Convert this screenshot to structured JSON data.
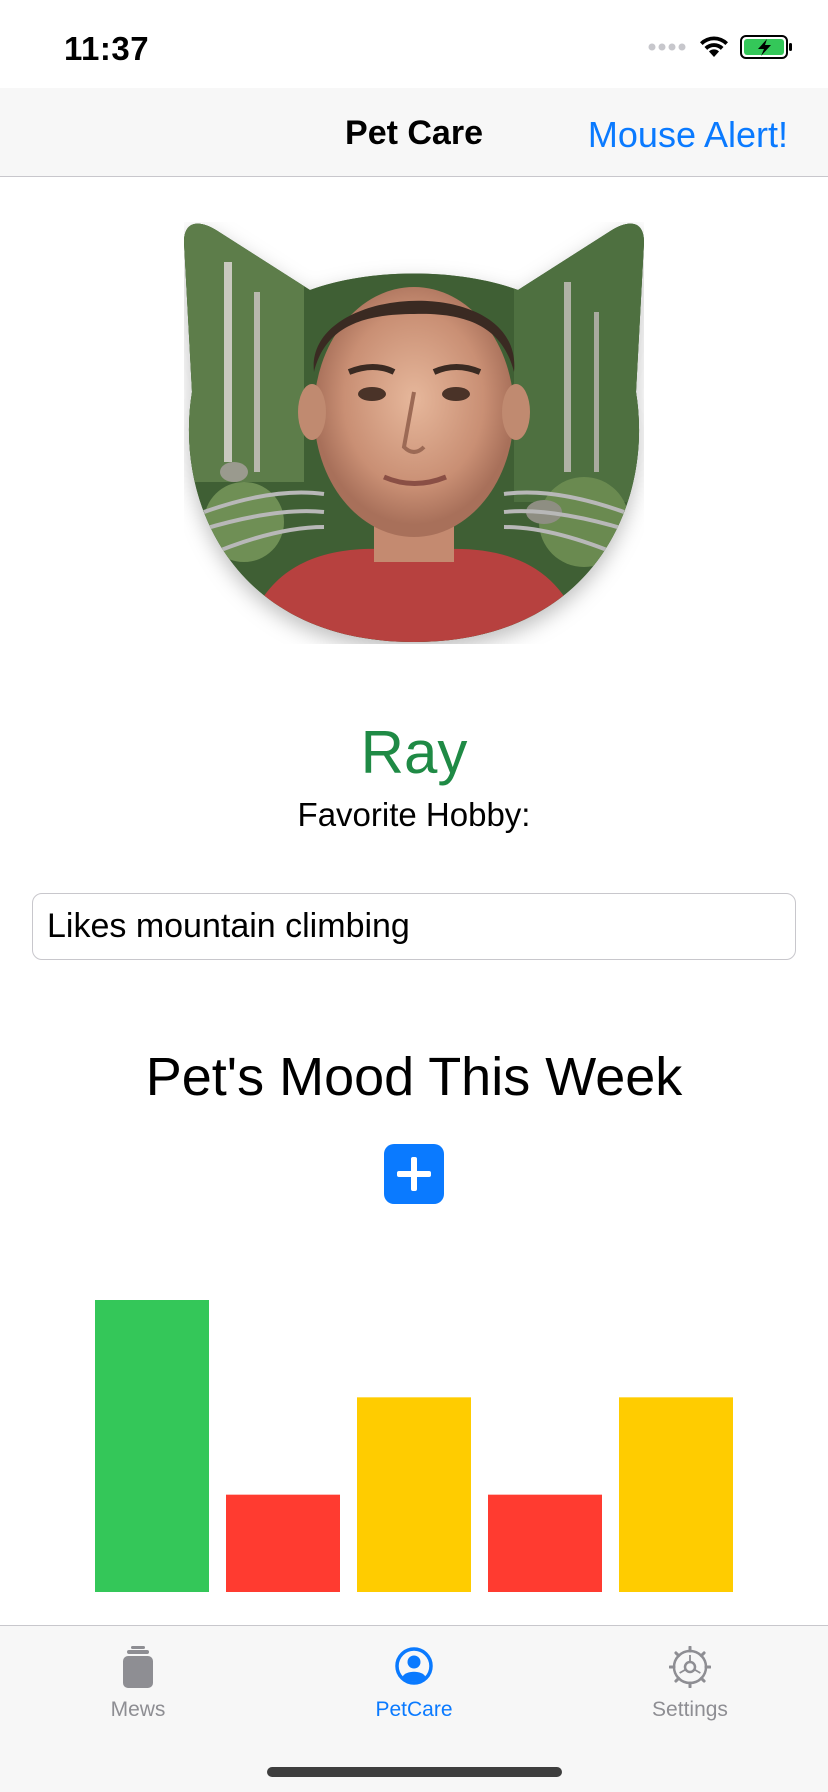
{
  "status_bar": {
    "time": "11:37"
  },
  "nav": {
    "title": "Pet Care",
    "action_label": "Mouse Alert!"
  },
  "profile": {
    "name": "Ray",
    "hobby_label": "Favorite Hobby:",
    "hobby_value": "Likes mountain climbing"
  },
  "mood": {
    "title": "Pet's Mood This Week",
    "add_icon": "plus-icon"
  },
  "chart_data": {
    "type": "bar",
    "values": [
      3,
      1,
      2,
      1,
      2
    ],
    "colors": [
      "#34c759",
      "#ff3b30",
      "#ffcc00",
      "#ff3b30",
      "#ffcc00"
    ],
    "ylim": [
      0,
      3
    ],
    "title": "",
    "xlabel": "",
    "ylabel": ""
  },
  "tabs": [
    {
      "label": "Mews",
      "icon": "cup-icon",
      "selected": false
    },
    {
      "label": "PetCare",
      "icon": "person-circle-icon",
      "selected": true
    },
    {
      "label": "Settings",
      "icon": "gear-icon",
      "selected": false
    }
  ],
  "colors": {
    "accent": "#0a7aff",
    "name_green": "#1f8a45",
    "tab_inactive": "#8e8e93"
  }
}
